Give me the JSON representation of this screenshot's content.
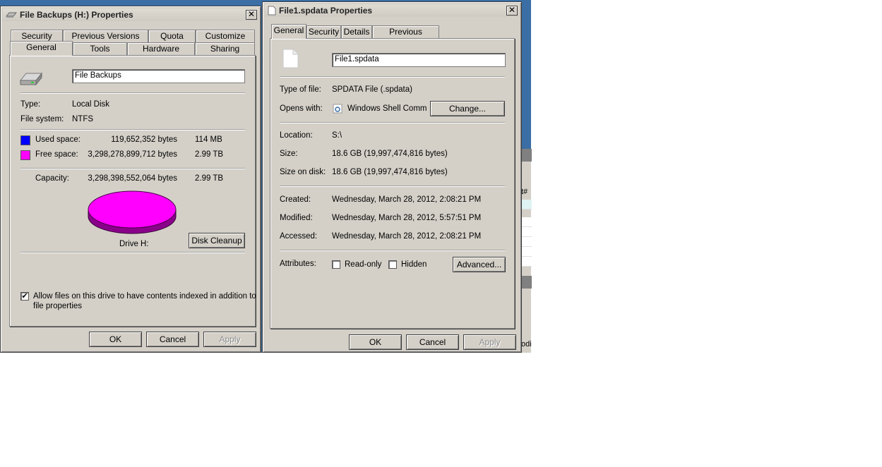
{
  "colors": {
    "used_space": "#0000ff",
    "free_space": "#ff00ff"
  },
  "drive_dialog": {
    "title": "File Backups (H:) Properties",
    "close_icon": "close-icon",
    "tabs_row1": [
      "Security",
      "Previous Versions",
      "Quota",
      "Customize"
    ],
    "tabs_row2": [
      "General",
      "Tools",
      "Hardware",
      "Sharing"
    ],
    "active_tab": "General",
    "name_value": "File Backups",
    "type_label": "Type:",
    "type_value": "Local Disk",
    "fs_label": "File system:",
    "fs_value": "NTFS",
    "used_label": "Used space:",
    "used_bytes": "119,652,352 bytes",
    "used_size": "114 MB",
    "free_label": "Free space:",
    "free_bytes": "3,298,278,899,712 bytes",
    "free_size": "2.99 TB",
    "capacity_label": "Capacity:",
    "capacity_bytes": "3,298,398,552,064 bytes",
    "capacity_size": "2.99 TB",
    "used_fraction": 4e-05,
    "drive_label": "Drive H:",
    "disk_cleanup": "Disk Cleanup",
    "index_line1": "Allow files on this drive to have contents indexed in addition to",
    "index_line2": "file properties",
    "index_checked": "✔",
    "ok": "OK",
    "cancel": "Cancel",
    "apply": "Apply"
  },
  "file_dialog": {
    "title": "File1.spdata Properties",
    "tabs": [
      "General",
      "Security",
      "Details",
      "Previous Versions"
    ],
    "active_tab": "General",
    "name_value": "File1.spdata",
    "type_label": "Type of file:",
    "type_value": "SPDATA File (.spdata)",
    "opens_label": "Opens with:",
    "opens_value": "Windows Shell Commor",
    "change": "Change...",
    "location_label": "Location:",
    "location_value": "S:\\",
    "size_label": "Size:",
    "size_value": "18.6 GB (19,997,474,816 bytes)",
    "size_disk_label": "Size on disk:",
    "size_disk_value": "18.6 GB (19,997,474,816 bytes)",
    "created_label": "Created:",
    "created_value": "Wednesday, March 28, 2012, 2:08:21 PM",
    "modified_label": "Modified:",
    "modified_value": "Wednesday, March 28, 2012, 5:57:51 PM",
    "accessed_label": "Accessed:",
    "accessed_value": "Wednesday, March 28, 2012, 2:08:21 PM",
    "attributes_label": "Attributes:",
    "readonly": "Read-only",
    "hidden": "Hidden",
    "advanced": "Advanced...",
    "ok": "OK",
    "cancel": "Cancel",
    "apply": "Apply"
  },
  "background": {
    "col_header_fragment": "t#",
    "bottom_fragment": "odi"
  }
}
